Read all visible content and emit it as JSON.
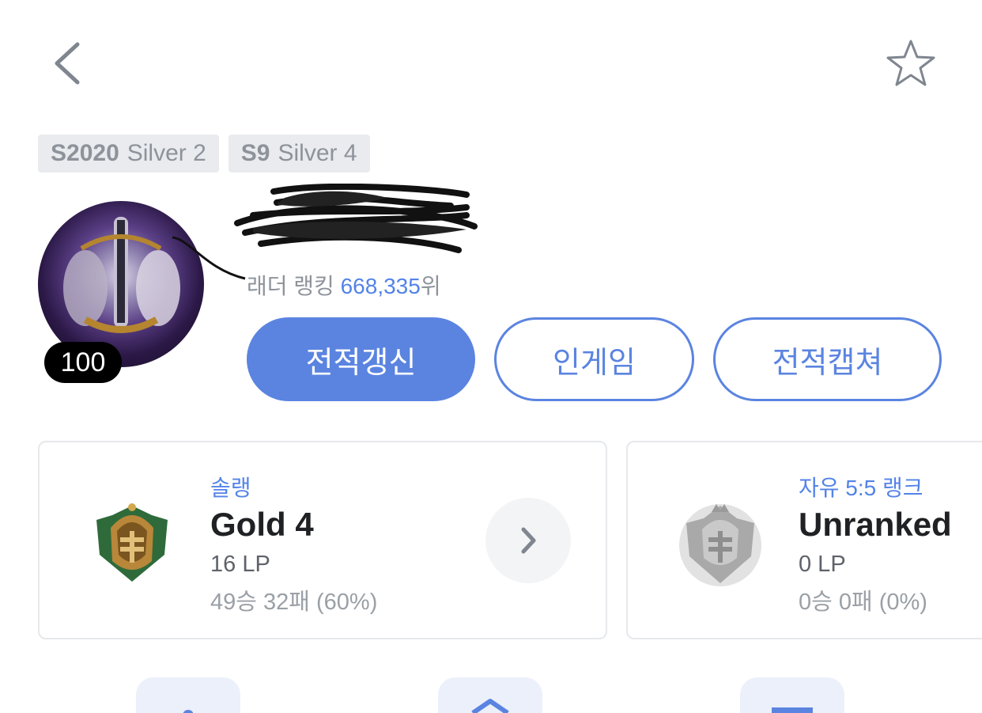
{
  "header": {
    "back_icon": "chevron-left-icon",
    "favorite_icon": "star-outline-icon"
  },
  "seasons": [
    {
      "season": "S2020",
      "tier": "Silver 2"
    },
    {
      "season": "S9",
      "tier": "Silver 4"
    }
  ],
  "profile": {
    "level": "100",
    "ladder_label": "래더 랭킹",
    "ladder_rank": "668,335",
    "ladder_suffix": "위"
  },
  "actions": {
    "refresh": "전적갱신",
    "ingame": "인게임",
    "capture": "전적캡쳐"
  },
  "ranks": {
    "solo": {
      "queue": "솔랭",
      "tier": "Gold 4",
      "lp": "16 LP",
      "record": "49승 32패 (60%)",
      "emblem_icon": "gold-emblem-icon"
    },
    "flex": {
      "queue": "자유 5:5 랭크",
      "tier": "Unranked",
      "lp": "0 LP",
      "record": "0승 0패 (0%)",
      "emblem_icon": "unranked-emblem-icon"
    }
  },
  "colors": {
    "accent": "#5b84e1",
    "link_blue": "#5383e8",
    "badge_bg": "#e9ebee",
    "muted_text": "#8e939b"
  }
}
